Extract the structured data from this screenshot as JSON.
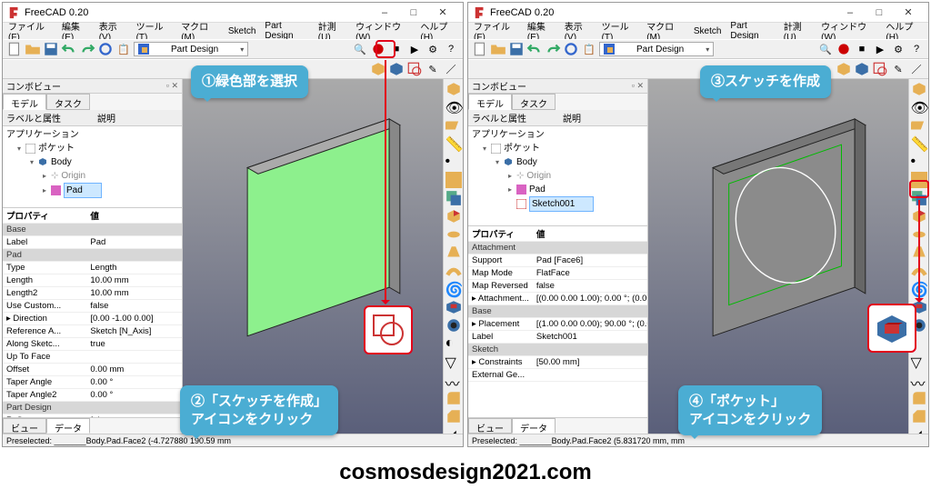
{
  "app_title": "FreeCAD 0.20",
  "menu": [
    "ファイル(F)",
    "編集(E)",
    "表示(V)",
    "ツール(T)",
    "マクロ(M)",
    "Sketch",
    "Part Design",
    "計測(U)",
    "ウィンドウ(W)",
    "ヘルプ(H)"
  ],
  "workbench": "Part Design",
  "combo_title": "コンボビュー",
  "tabs_top": {
    "model": "モデル",
    "task": "タスク"
  },
  "labels_hdr": {
    "label": "ラベルと属性",
    "desc": "説明"
  },
  "app_label": "アプリケーション",
  "left": {
    "tree": {
      "pocket": "ポケット",
      "body": "Body",
      "origin": "Origin",
      "pad": "Pad"
    },
    "pad_selected": true,
    "prop_title": "プロパティ",
    "prop_val": "値",
    "groups": [
      "Base",
      "Pad",
      "Part Design"
    ],
    "rows": [
      [
        "Label",
        "Pad"
      ],
      [
        "Type",
        "Length"
      ],
      [
        "Length",
        "10.00 mm"
      ],
      [
        "Length2",
        "10.00 mm"
      ],
      [
        "Use Custom...",
        "false"
      ],
      [
        "Direction",
        "[0.00 -1.00 0.00]"
      ],
      [
        "Reference A...",
        "Sketch [N_Axis]"
      ],
      [
        "Along Sketc...",
        "true"
      ],
      [
        "Up To Face",
        ""
      ],
      [
        "Offset",
        "0.00 mm"
      ],
      [
        "Taper Angle",
        "0.00 °"
      ],
      [
        "Taper Angle2",
        "0.00 °"
      ],
      [
        "Refine",
        "false"
      ]
    ],
    "status": "Preselected: _______Body.Pad.Face2 (-4.727880 190.59 mm"
  },
  "right": {
    "tree": {
      "pocket": "ポケット",
      "body": "Body",
      "origin": "Origin",
      "pad": "Pad",
      "sketch": "Sketch001"
    },
    "prop_title": "プロパティ",
    "prop_val": "値",
    "rows": [
      [
        "Support",
        "Pad [Face6]"
      ],
      [
        "Map Mode",
        "FlatFace"
      ],
      [
        "Map Reversed",
        "false"
      ],
      [
        "Attachment...",
        "[(0.00 0.00 1.00); 0.00 °; (0.00..."
      ],
      [
        "Placement",
        "[(1.00 0.00 0.00); 90.00 °; (0.0..."
      ],
      [
        "Label",
        "Sketch001"
      ],
      [
        "Constraints",
        "[50.00 mm]"
      ],
      [
        "External Ge...",
        ""
      ]
    ],
    "groups": [
      "Attachment",
      "Base",
      "Sketch"
    ],
    "status": "Preselected: _______Body.Pad.Face2 (5.831720 mm, mm"
  },
  "btabs": {
    "view": "ビュー",
    "data": "データ"
  },
  "annotations": {
    "a1": "①緑色部を選択",
    "a2": "②「スケッチを作成」\nアイコンをクリック",
    "a3": "③スケッチを作成",
    "a4": "④「ポケット」\nアイコンをクリック"
  },
  "watermark": "cosmosdesign2021.com"
}
